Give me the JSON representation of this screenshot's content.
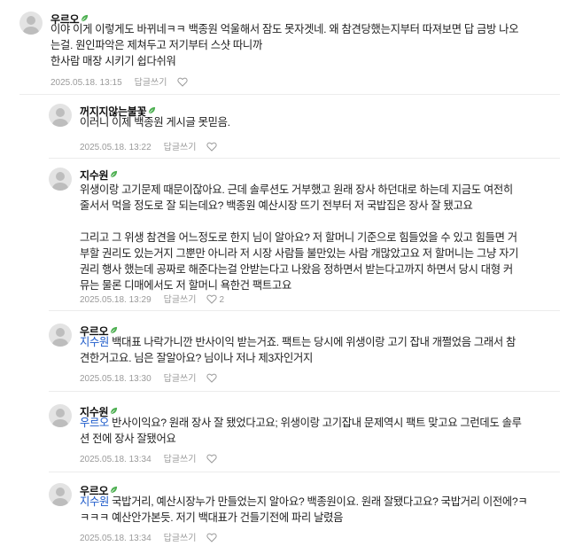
{
  "comments": [
    {
      "nickname": "우르오",
      "date": "2025.05.18. 13:15",
      "reply_label": "답글쓰기",
      "body_lines": [
        "이야 이게 이렇게도 바뀌네ㅋㅋ 백종원 억울해서 잠도 못자겟네. 왜 참견당했는지부터 따져보면 답 금방 나오",
        "는걸. 원인파악은 제쳐두고 저기부터 스샷 따니까",
        "한사람 매장 시키기 쉽다쉬워"
      ]
    },
    {
      "nickname": "꺼지지않는불꽃",
      "date": "2025.05.18. 13:22",
      "reply_label": "답글쓰기",
      "body_lines": [
        "이러니 이제 백종원 게시글 못믿음."
      ]
    },
    {
      "nickname": "지수원",
      "date": "2025.05.18. 13:29",
      "reply_label": "답글쓰기",
      "like_count": "2",
      "body_lines": [
        "위생이랑 고기문제 때문이잖아요. 근데 솔루션도 거부했고 원래 장사 하던대로 하는데 지금도 여전히",
        "줄서서 먹을 정도로 잘 되는데요? 백종원 예산시장 뜨기 전부터 저 국밥집은 장사 잘 됐고요",
        "",
        "그리고 그 위생 참견을 어느정도로 한지 님이 알아요? 저 할머니 기준으로 힘들었을 수 있고 힘들면 거",
        "부할 권리도 있는거지 그뿐만 아니라 저 시장 사람들 불만있는 사람 개많았고요 저 할머니는 그냥 자기",
        "권리 행사 했는데 공짜로 해준다는걸 안받는다고 나왔음 정하면서 받는다고까지 하면서 당시 대형 커",
        "뮤는 물론 디매에서도 저 할머니 욕한건 팩트고요"
      ]
    },
    {
      "nickname": "우르오",
      "date": "2025.05.18. 13:30",
      "reply_label": "답글쓰기",
      "mention": "지수원",
      "body_lines": [
        " 백대표 나락가니깐 반사이익 받는거죠. 팩트는 당시에 위생이랑 고기 잡내 개쩔었음 그래서 참",
        "견한거고요. 님은 잘알아요? 님이나 저나 제3자인거지"
      ]
    },
    {
      "nickname": "지수원",
      "date": "2025.05.18. 13:34",
      "reply_label": "답글쓰기",
      "mention": "우르오",
      "body_lines": [
        " 반사이익요? 원래 장사 잘 됐었다고요; 위생이랑 고기잡내 문제역시 팩트 맞고요 그런데도 솔루",
        "션 전에 장사 잘됐어요"
      ]
    },
    {
      "nickname": "우르오",
      "date": "2025.05.18. 13:34",
      "reply_label": "답글쓰기",
      "mention": "지수원",
      "body_lines": [
        " 국밥거리, 예산시장누가 만들었는지 알아요? 백종원이요. 원래 잘됐다고요? 국밥거리 이전에?ㅋ",
        "ㅋㅋㅋ 예산안가본듯. 저기 백대표가 건들기전에 파리 날렸음"
      ]
    }
  ],
  "colors": {
    "mention": "#1a58c9",
    "leaf": "#4caf50",
    "meta": "#9a9a9a"
  },
  "icons": {
    "verified": "leaf-icon",
    "like": "heart-icon",
    "avatar": "default-avatar"
  }
}
